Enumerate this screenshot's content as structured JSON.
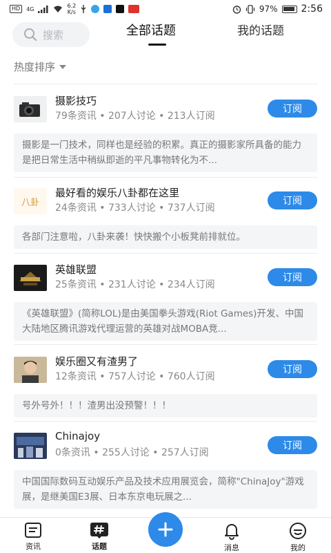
{
  "status_bar": {
    "hd": "HD",
    "net": "4G",
    "speed_top": "6.2",
    "speed_bottom": "K/s",
    "battery": "97%",
    "time": "2:56"
  },
  "header": {
    "search_placeholder": "搜索",
    "tab_all": "全部话题",
    "tab_mine": "我的话题"
  },
  "sort": {
    "label": "热度排序"
  },
  "topics": [
    {
      "name": "摄影技巧",
      "meta": "79条资讯 • 207人讨论 • 213人订阅",
      "button": "订阅",
      "desc": "摄影是一门技术，同样也是经验的积累。真正的摄影家所具备的能力是把日常生活中稍纵即逝的平凡事物转化为不..."
    },
    {
      "name": "最好看的娱乐八卦都在这里",
      "meta": "24条资讯 • 733人讨论 • 737人订阅",
      "button": "订阅",
      "thumb_text": "八卦",
      "desc": "各部门注意啦，八卦来袭！快快搬个小板凳前排就位。"
    },
    {
      "name": "英雄联盟",
      "meta": "25条资讯 • 231人讨论 • 234人订阅",
      "button": "订阅",
      "desc": "《英雄联盟》(简称LOL)是由美国拳头游戏(Riot Games)开发、中国大陆地区腾讯游戏代理运营的英雄对战MOBA竞..."
    },
    {
      "name": "娱乐圈又有渣男了",
      "meta": "12条资讯 • 757人讨论 • 760人订阅",
      "button": "订阅",
      "desc": "号外号外！！！渣男出没预警！！！"
    },
    {
      "name": "Chinajoy",
      "meta": "0条资讯 • 255人讨论 • 257人订阅",
      "button": "订阅",
      "desc": "中国国际数码互动娱乐产品及技术应用展览会，简称\"ChinaJoy\"游戏展，是继美国E3展、日本东京电玩展之..."
    }
  ],
  "bottom_nav": {
    "zixun": "资讯",
    "huati": "话题",
    "xiaoxi": "消息",
    "wode": "我的"
  },
  "colors": {
    "accent": "#2d8ae8"
  }
}
